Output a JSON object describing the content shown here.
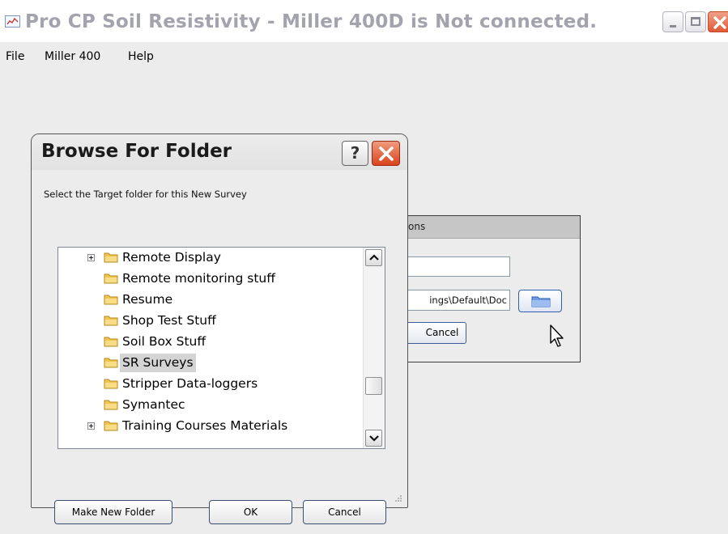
{
  "window": {
    "title": "Pro CP Soil Resistivity - Miller 400D is Not connected."
  },
  "menu": [
    "File",
    "Miller 400",
    "Help"
  ],
  "background_panel": {
    "header_fragment": "ons",
    "path_fragment": "ings\\Default\\Doc",
    "cancel_label": "Cancel"
  },
  "dialog": {
    "title": "Browse For Folder",
    "help_glyph": "?",
    "instruction": "Select the Target folder for this New Survey",
    "folders": [
      {
        "label": "Remote Display",
        "expandable": true,
        "selected": false
      },
      {
        "label": "Remote monitoring stuff",
        "expandable": false,
        "selected": false
      },
      {
        "label": "Resume",
        "expandable": false,
        "selected": false
      },
      {
        "label": "Shop Test Stuff",
        "expandable": false,
        "selected": false
      },
      {
        "label": "Soil Box Stuff",
        "expandable": false,
        "selected": false
      },
      {
        "label": "SR Surveys",
        "expandable": false,
        "selected": true
      },
      {
        "label": "Stripper Data-loggers",
        "expandable": false,
        "selected": false
      },
      {
        "label": "Symantec",
        "expandable": false,
        "selected": false
      },
      {
        "label": "Training Courses Materials",
        "expandable": true,
        "selected": false
      }
    ],
    "buttons": {
      "make_new_folder": "Make New Folder",
      "ok": "OK",
      "cancel": "Cancel"
    }
  },
  "colors": {
    "close_red": "#df5a35",
    "folder_yellow": "#f3c54c",
    "selection_gray": "#d4d4d4",
    "title_gray": "#a3a3ad"
  },
  "icons": [
    "app-chart-icon",
    "minimize-icon",
    "maximize-icon",
    "close-icon",
    "help-icon",
    "folder-icon",
    "expand-plus-icon",
    "scroll-up-arrow-icon",
    "scroll-down-arrow-icon",
    "open-folder-icon",
    "mouse-cursor-icon",
    "resize-grip-icon"
  ]
}
